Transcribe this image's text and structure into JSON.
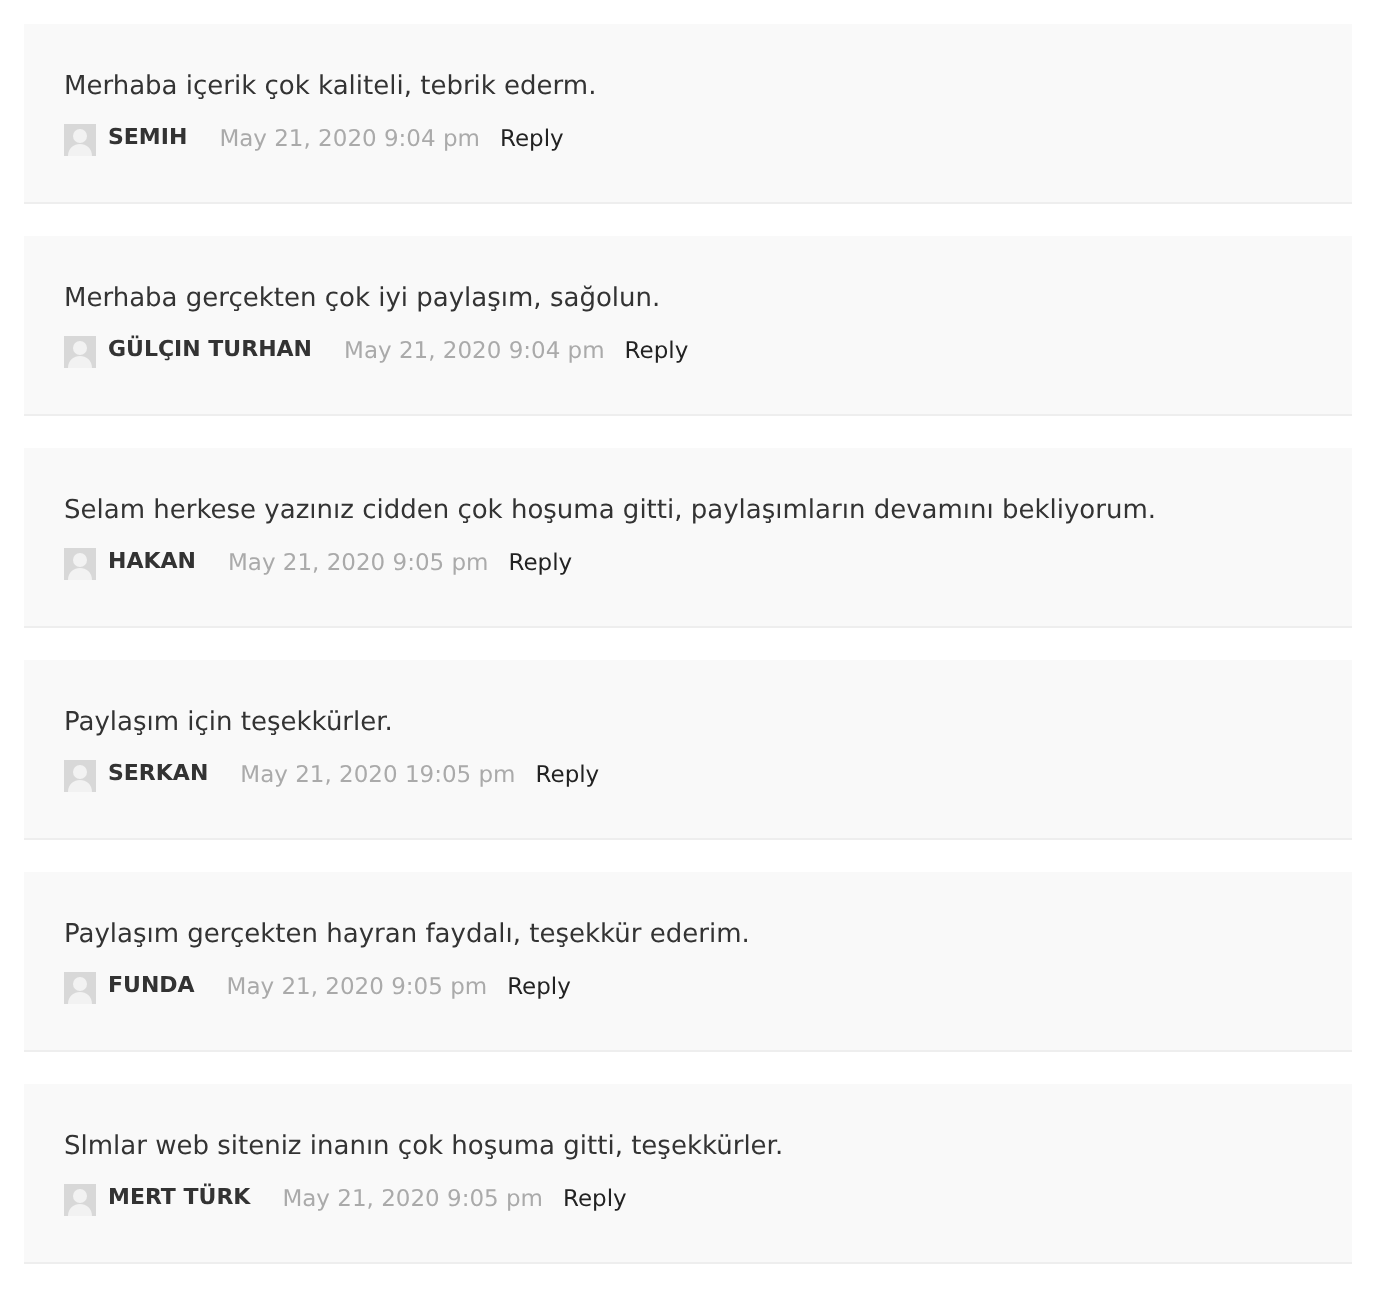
{
  "comments": [
    {
      "text": "Merhaba içerik çok kaliteli, tebrik ederm.",
      "author": "SEMIH",
      "date": "May 21, 2020 9:04 pm",
      "reply": "Reply"
    },
    {
      "text": "Merhaba gerçekten çok iyi paylaşım, sağolun.",
      "author": "GÜLÇIN TURHAN",
      "date": "May 21, 2020 9:04 pm",
      "reply": "Reply"
    },
    {
      "text": "Selam herkese yazınız cidden çok hoşuma gitti, paylaşımların devamını bekliyorum.",
      "author": "HAKAN",
      "date": "May 21, 2020 9:05 pm",
      "reply": "Reply"
    },
    {
      "text": "Paylaşım için teşekkürler.",
      "author": "SERKAN",
      "date": "May 21, 2020 19:05 pm",
      "reply": "Reply"
    },
    {
      "text": "Paylaşım gerçekten hayran faydalı, teşekkür ederim.",
      "author": "FUNDA",
      "date": "May 21, 2020 9:05 pm",
      "reply": "Reply"
    },
    {
      "text": "Slmlar web siteniz inanın çok hoşuma gitti, teşekkürler.",
      "author": "MERT TÜRK",
      "date": "May 21, 2020 9:05 pm",
      "reply": "Reply"
    }
  ]
}
